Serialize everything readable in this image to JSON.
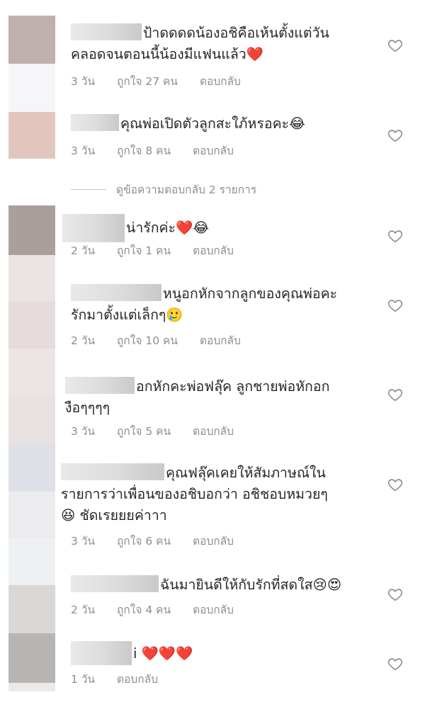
{
  "comments": [
    {
      "text": "ป้าดดดดน้องอชิคือเห้นตั้งแต่วัน\nคลอดจนตอนนี้น้องมีแฟนแล้ว❤️",
      "time": "3 วัน",
      "likes": "ถูกใจ 27 คน",
      "reply": "ตอบกลับ"
    },
    {
      "text": "คุณพ่อเปิดตัวลูกสะใภ้หรอคะ😂",
      "time": "3 วัน",
      "likes": "ถูกใจ 8 คน",
      "reply": "ตอบกลับ"
    },
    {
      "text": "น่ารักค่ะ❤️😂",
      "time": "2 วัน",
      "likes": "ถูกใจ 1 คน",
      "reply": "ตอบกลับ"
    },
    {
      "text": "หนูอกหักจากลูกของคุณพ่อคะ\nรักมาตั้งแต่เล็กๆ🥲",
      "time": "2 วัน",
      "likes": "ถูกใจ 10 คน",
      "reply": "ตอบกลับ"
    },
    {
      "text": "อกหักคะพ่อฟลุ๊ค ลูกชายพ่อหักอก\nงือๆๆๆๆ",
      "time": "3 วัน",
      "likes": "ถูกใจ 5 คน",
      "reply": "ตอบกลับ"
    },
    {
      "text": "คุณฟลุ๊คเคยให้สัมภาษณ์ใน\nรายการว่าเพื่อนของอชิบอกว่า อชิชอบหมวยๆ\n😆 ชัดเรยยยค่าาา",
      "time": "3 วัน",
      "likes": "ถูกใจ 6 คน",
      "reply": "ตอบกลับ"
    },
    {
      "text": "ฉันมายินดีให้กับรักที่สดใส😢😍",
      "time": "2 วัน",
      "likes": "ถูกใจ 4 คน",
      "reply": "ตอบกลับ"
    },
    {
      "text": "i ❤️❤️❤️",
      "time": "1 วัน",
      "likes": "",
      "reply": "ตอบกลับ"
    }
  ],
  "view_replies": {
    "label": "ดูข้อความตอบกลับ 2 รายการ"
  },
  "icons": {
    "like": "heart-outline-icon"
  },
  "colors": {
    "text": "#262626",
    "meta": "#8e8e8e",
    "heart": "#8e8e8e"
  }
}
